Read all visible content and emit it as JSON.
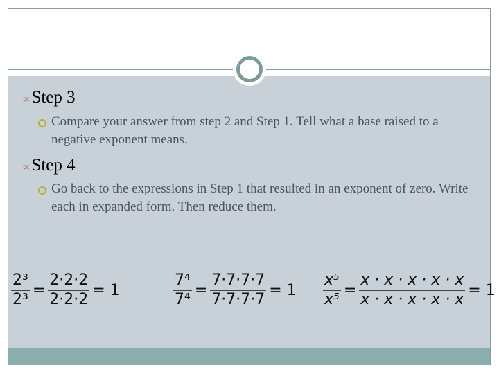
{
  "slide": {
    "colors": {
      "panel": "#c7d1d7",
      "footer": "#8aadad",
      "circle": "#7e9b9b",
      "bullet": "#b8b030"
    },
    "sections": [
      {
        "heading": "Step 3",
        "text": "Compare your answer from step 2 and Step 1.  Tell what a base raised to a negative exponent means."
      },
      {
        "heading": "Step 4",
        "text": "Go back to the expressions in Step 1 that resulted in an exponent of zero.  Write each in expanded form.  Then reduce them."
      }
    ],
    "equations": [
      {
        "num": "2³",
        "den": "2³",
        "exp_num": "2·2·2",
        "exp_den": "2·2·2",
        "result": "= 1"
      },
      {
        "num": "7⁴",
        "den": "7⁴",
        "exp_num": "7·7·7·7",
        "exp_den": "7·7·7·7",
        "result": "= 1"
      },
      {
        "num": "x⁵",
        "den": "x⁵",
        "exp_num": "x · x · x · x · x",
        "exp_den": "x · x · x · x · x",
        "result": "= 1"
      }
    ],
    "eq_sign": "="
  }
}
